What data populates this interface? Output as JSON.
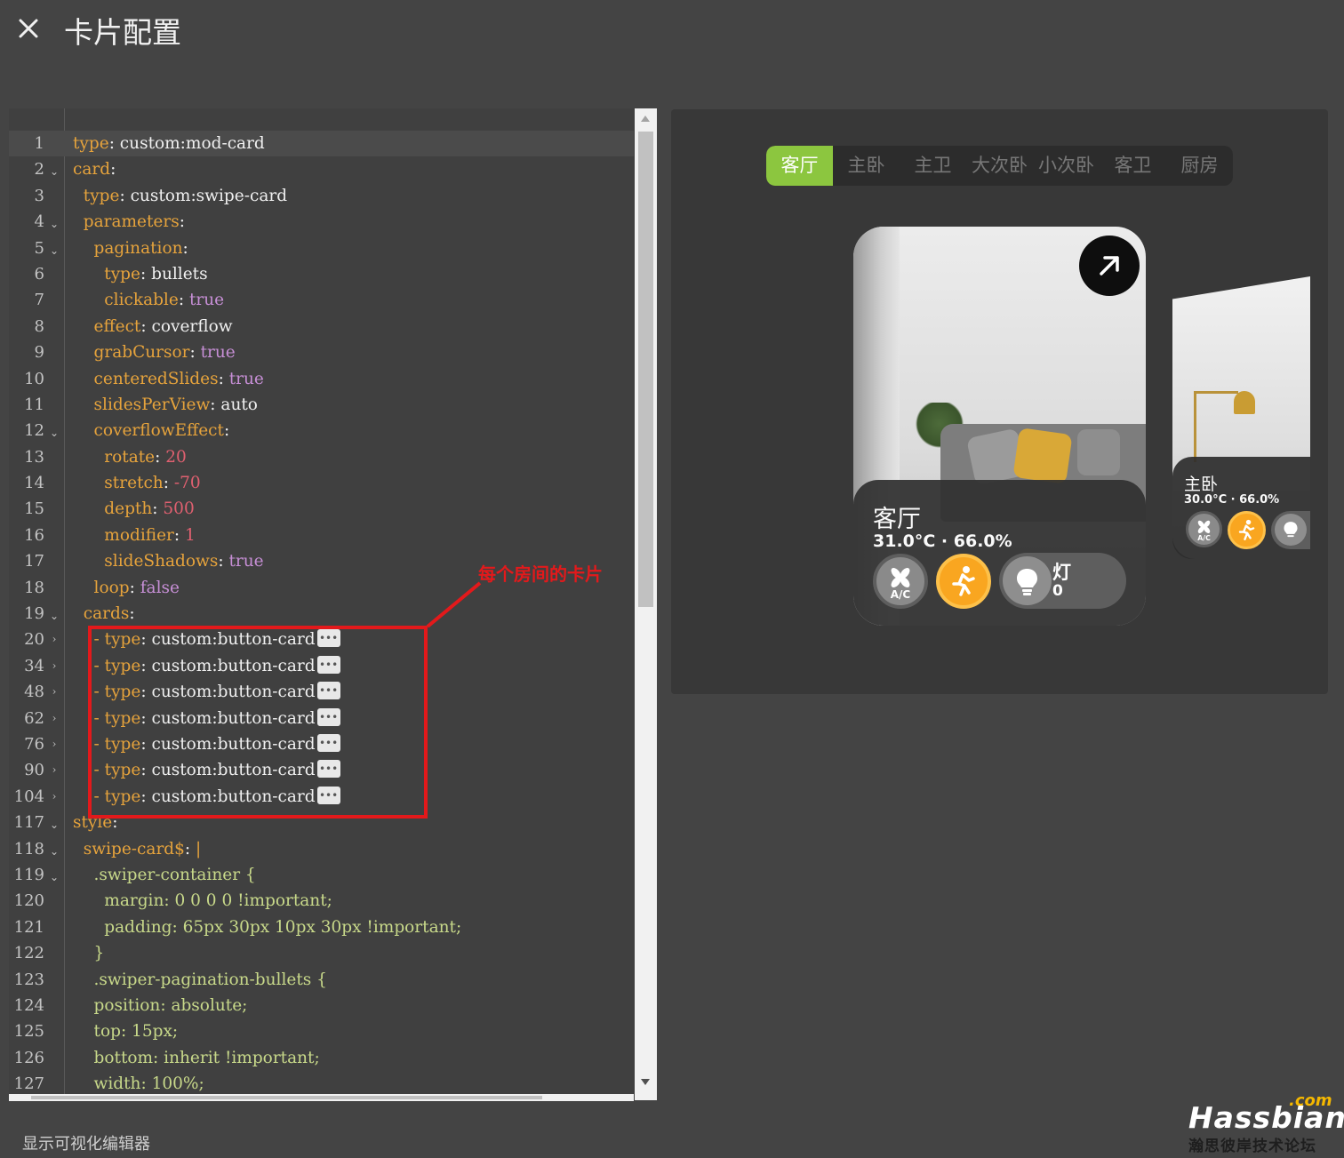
{
  "header": {
    "title": "卡片配置"
  },
  "editor": {
    "lines": [
      {
        "n": "1",
        "fold": "",
        "active": true,
        "parts": [
          [
            "k",
            "type"
          ],
          [
            "s",
            ": custom:mod-card"
          ]
        ]
      },
      {
        "n": "2",
        "fold": "down",
        "parts": [
          [
            "k",
            "card"
          ],
          [
            "s",
            ":"
          ]
        ]
      },
      {
        "n": "3",
        "fold": "",
        "parts": [
          [
            "s",
            "  "
          ],
          [
            "k",
            "type"
          ],
          [
            "s",
            ": custom:swipe-card"
          ]
        ]
      },
      {
        "n": "4",
        "fold": "down",
        "parts": [
          [
            "s",
            "  "
          ],
          [
            "k",
            "parameters"
          ],
          [
            "s",
            ":"
          ]
        ]
      },
      {
        "n": "5",
        "fold": "down",
        "parts": [
          [
            "s",
            "    "
          ],
          [
            "k",
            "pagination"
          ],
          [
            "s",
            ":"
          ]
        ]
      },
      {
        "n": "6",
        "fold": "",
        "parts": [
          [
            "s",
            "      "
          ],
          [
            "k",
            "type"
          ],
          [
            "s",
            ": bullets"
          ]
        ]
      },
      {
        "n": "7",
        "fold": "",
        "parts": [
          [
            "s",
            "      "
          ],
          [
            "k",
            "clickable"
          ],
          [
            "s",
            ": "
          ],
          [
            "b",
            "true"
          ]
        ]
      },
      {
        "n": "8",
        "fold": "",
        "parts": [
          [
            "s",
            "    "
          ],
          [
            "k",
            "effect"
          ],
          [
            "s",
            ": coverflow"
          ]
        ]
      },
      {
        "n": "9",
        "fold": "",
        "parts": [
          [
            "s",
            "    "
          ],
          [
            "k",
            "grabCursor"
          ],
          [
            "s",
            ": "
          ],
          [
            "b",
            "true"
          ]
        ]
      },
      {
        "n": "10",
        "fold": "",
        "parts": [
          [
            "s",
            "    "
          ],
          [
            "k",
            "centeredSlides"
          ],
          [
            "s",
            ": "
          ],
          [
            "b",
            "true"
          ]
        ]
      },
      {
        "n": "11",
        "fold": "",
        "parts": [
          [
            "s",
            "    "
          ],
          [
            "k",
            "slidesPerView"
          ],
          [
            "s",
            ": auto"
          ]
        ]
      },
      {
        "n": "12",
        "fold": "down",
        "parts": [
          [
            "s",
            "    "
          ],
          [
            "k",
            "coverflowEffect"
          ],
          [
            "s",
            ":"
          ]
        ]
      },
      {
        "n": "13",
        "fold": "",
        "parts": [
          [
            "s",
            "      "
          ],
          [
            "k",
            "rotate"
          ],
          [
            "s",
            ": "
          ],
          [
            "n",
            "20"
          ]
        ]
      },
      {
        "n": "14",
        "fold": "",
        "parts": [
          [
            "s",
            "      "
          ],
          [
            "k",
            "stretch"
          ],
          [
            "s",
            ": "
          ],
          [
            "n",
            "-70"
          ]
        ]
      },
      {
        "n": "15",
        "fold": "",
        "parts": [
          [
            "s",
            "      "
          ],
          [
            "k",
            "depth"
          ],
          [
            "s",
            ": "
          ],
          [
            "n",
            "500"
          ]
        ]
      },
      {
        "n": "16",
        "fold": "",
        "parts": [
          [
            "s",
            "      "
          ],
          [
            "k",
            "modifier"
          ],
          [
            "s",
            ": "
          ],
          [
            "n",
            "1"
          ]
        ]
      },
      {
        "n": "17",
        "fold": "",
        "parts": [
          [
            "s",
            "      "
          ],
          [
            "k",
            "slideShadows"
          ],
          [
            "s",
            ": "
          ],
          [
            "b",
            "true"
          ]
        ]
      },
      {
        "n": "18",
        "fold": "",
        "parts": [
          [
            "s",
            "    "
          ],
          [
            "k",
            "loop"
          ],
          [
            "s",
            ": "
          ],
          [
            "b",
            "false"
          ]
        ]
      },
      {
        "n": "19",
        "fold": "down",
        "parts": [
          [
            "s",
            "  "
          ],
          [
            "k",
            "cards"
          ],
          [
            "s",
            ":"
          ]
        ]
      },
      {
        "n": "20",
        "fold": "right",
        "dots": true,
        "parts": [
          [
            "s",
            "    "
          ],
          [
            "k",
            "- type"
          ],
          [
            "s",
            ": custom:button-card"
          ]
        ]
      },
      {
        "n": "34",
        "fold": "right",
        "dots": true,
        "parts": [
          [
            "s",
            "    "
          ],
          [
            "k",
            "- type"
          ],
          [
            "s",
            ": custom:button-card"
          ]
        ]
      },
      {
        "n": "48",
        "fold": "right",
        "dots": true,
        "parts": [
          [
            "s",
            "    "
          ],
          [
            "k",
            "- type"
          ],
          [
            "s",
            ": custom:button-card"
          ]
        ]
      },
      {
        "n": "62",
        "fold": "right",
        "dots": true,
        "parts": [
          [
            "s",
            "    "
          ],
          [
            "k",
            "- type"
          ],
          [
            "s",
            ": custom:button-card"
          ]
        ]
      },
      {
        "n": "76",
        "fold": "right",
        "dots": true,
        "parts": [
          [
            "s",
            "    "
          ],
          [
            "k",
            "- type"
          ],
          [
            "s",
            ": custom:button-card"
          ]
        ]
      },
      {
        "n": "90",
        "fold": "right",
        "dots": true,
        "parts": [
          [
            "s",
            "    "
          ],
          [
            "k",
            "- type"
          ],
          [
            "s",
            ": custom:button-card"
          ]
        ]
      },
      {
        "n": "104",
        "fold": "right",
        "dots": true,
        "parts": [
          [
            "s",
            "    "
          ],
          [
            "k",
            "- type"
          ],
          [
            "s",
            ": custom:button-card"
          ]
        ]
      },
      {
        "n": "117",
        "fold": "down",
        "parts": [
          [
            "k",
            "style"
          ],
          [
            "s",
            ":"
          ]
        ]
      },
      {
        "n": "118",
        "fold": "down",
        "parts": [
          [
            "s",
            "  "
          ],
          [
            "k",
            "swipe-card$"
          ],
          [
            "s",
            ": "
          ],
          [
            "k",
            "|"
          ]
        ]
      },
      {
        "n": "119",
        "fold": "down",
        "parts": [
          [
            "s",
            "    "
          ],
          [
            "c",
            ".swiper-container {"
          ]
        ]
      },
      {
        "n": "120",
        "fold": "",
        "parts": [
          [
            "s",
            "      "
          ],
          [
            "c",
            "margin: 0 0 0 0 !important;"
          ]
        ]
      },
      {
        "n": "121",
        "fold": "",
        "parts": [
          [
            "s",
            "      "
          ],
          [
            "c",
            "padding: 65px 30px 10px 30px !important;"
          ]
        ]
      },
      {
        "n": "122",
        "fold": "",
        "parts": [
          [
            "s",
            "    "
          ],
          [
            "c",
            "}"
          ]
        ]
      },
      {
        "n": "123",
        "fold": "",
        "parts": [
          [
            "s",
            "    "
          ],
          [
            "c",
            ".swiper-pagination-bullets {"
          ]
        ]
      },
      {
        "n": "124",
        "fold": "",
        "parts": [
          [
            "s",
            "    "
          ],
          [
            "c",
            "position: absolute;"
          ]
        ]
      },
      {
        "n": "125",
        "fold": "",
        "parts": [
          [
            "s",
            "    "
          ],
          [
            "c",
            "top: 15px;"
          ]
        ]
      },
      {
        "n": "126",
        "fold": "",
        "parts": [
          [
            "s",
            "    "
          ],
          [
            "c",
            "bottom: inherit !important;"
          ]
        ]
      },
      {
        "n": "127",
        "fold": "",
        "parts": [
          [
            "s",
            "    "
          ],
          [
            "c",
            "width: 100%;"
          ]
        ]
      }
    ]
  },
  "annotation": {
    "label": "每个房间的卡片"
  },
  "preview": {
    "tabs": [
      "客厅",
      "主卧",
      "主卫",
      "大次卧",
      "小次卧",
      "客卫",
      "厨房"
    ],
    "active_tab": 0,
    "main_card": {
      "name": "客厅",
      "stats": "31.0°C · 66.0%",
      "light_label": "灯",
      "light_count": "0",
      "ac_label": "A/C"
    },
    "side_card": {
      "name": "主卧",
      "stats": "30.0°C · 66.0%",
      "ac_label": "A/C"
    }
  },
  "footer": {
    "visual_editor_link": "显示可视化编辑器"
  },
  "watermark": {
    "com": ".com",
    "brand": "Hassbian",
    "sub": "瀚思彼岸技术论坛"
  }
}
